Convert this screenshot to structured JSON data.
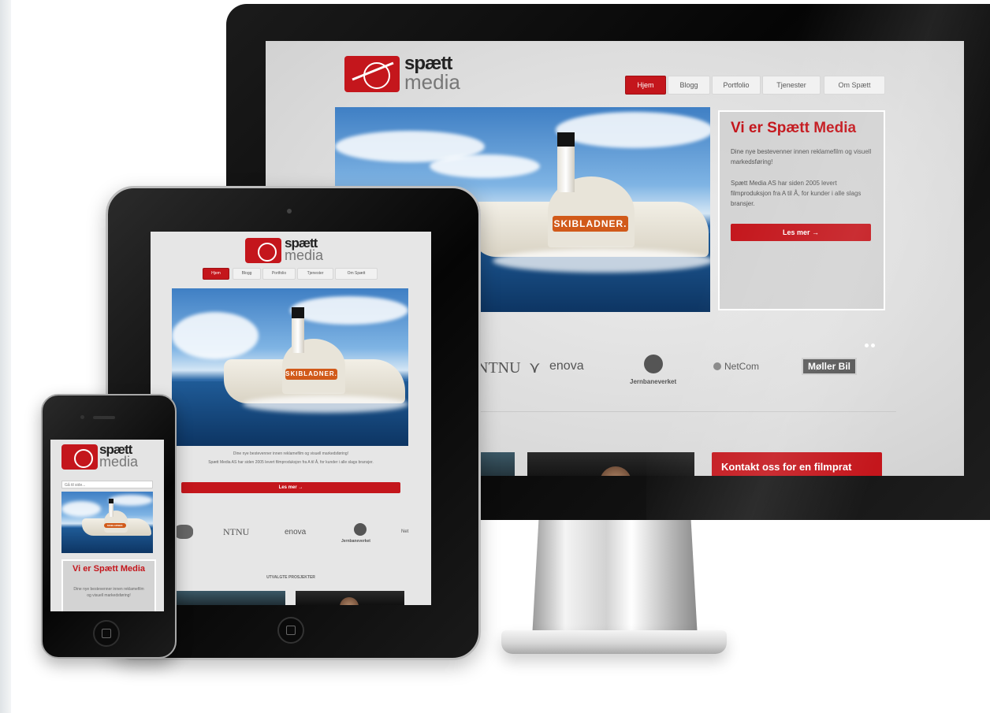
{
  "brand": {
    "name_top": "spætt",
    "name_bottom": "media",
    "accent": "#c4161c"
  },
  "nav": {
    "items": [
      "Hjem",
      "Blogg",
      "Portfolio",
      "Tjenester",
      "Om Spætt"
    ],
    "active": "Hjem"
  },
  "hero": {
    "ship_name": "SKIBLADNER."
  },
  "intro": {
    "heading": "Vi er Spætt Media",
    "text1": "Dine nye bestevenner innen reklamefilm og visuell markedsføring!",
    "text2": "Spætt Media AS har siden 2005 levert filmproduksjon fra A til Å, for kunder i alle slags bransjer.",
    "cta": "Les mer →"
  },
  "clients": [
    "NTNU",
    "enova",
    "Jernbaneverket",
    "NetCom",
    "Møller Bil"
  ],
  "tablet_clients": [
    "NTNU",
    "enova",
    "Jernbaneverket",
    "Net"
  ],
  "contact_cta": "Kontakt oss for en filmprat",
  "featured_projects": "UTVALGTE PROSJEKTER",
  "phone": {
    "search_placeholder": "Gå til side...",
    "heading": "Vi er Spætt Media"
  }
}
